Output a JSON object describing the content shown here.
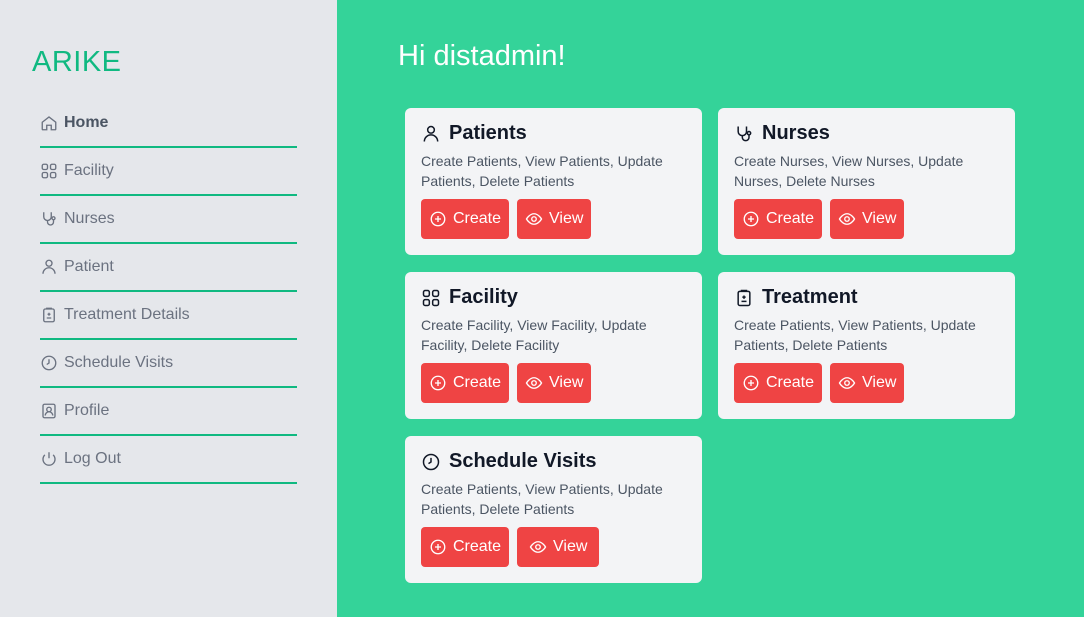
{
  "sidebar": {
    "brand": "ARIKE",
    "items": [
      {
        "label": "Home",
        "icon": "home-icon"
      },
      {
        "label": "Facility",
        "icon": "grid-icon"
      },
      {
        "label": "Nurses",
        "icon": "stethoscope-icon"
      },
      {
        "label": "Patient",
        "icon": "user-icon"
      },
      {
        "label": "Treatment Details",
        "icon": "clipboard-icon"
      },
      {
        "label": "Schedule Visits",
        "icon": "clock-icon"
      },
      {
        "label": "Profile",
        "icon": "profile-icon"
      },
      {
        "label": "Log Out",
        "icon": "power-icon"
      }
    ]
  },
  "main": {
    "greeting": "Hi distadmin!",
    "cards": [
      {
        "title": "Patients",
        "icon": "user-icon",
        "desc": "Create Patients, View Patients, Update Patients, Delete Patients",
        "create": "Create",
        "view": "View"
      },
      {
        "title": "Nurses",
        "icon": "stethoscope-icon",
        "desc": "Create Nurses, View Nurses, Update Nurses, Delete Nurses",
        "create": "Create",
        "view": "View"
      },
      {
        "title": "Facility",
        "icon": "grid-icon",
        "desc": "Create Facility, View Facility, Update Facility, Delete Facility",
        "create": "Create",
        "view": "View"
      },
      {
        "title": "Treatment",
        "icon": "clipboard-icon",
        "desc": "Create Patients, View Patients, Update Patients, Delete Patients",
        "create": "Create",
        "view": "View"
      },
      {
        "title": "Schedule Visits",
        "icon": "clock-icon",
        "desc": "Create Patients, View Patients, Update Patients, Delete Patients",
        "create": "Create",
        "view": "View"
      }
    ]
  },
  "colors": {
    "sidebar_bg": "#e5e7eb",
    "main_bg": "#34d399",
    "brand": "#10b981",
    "button": "#ef4444",
    "card_bg": "#f3f4f6"
  }
}
